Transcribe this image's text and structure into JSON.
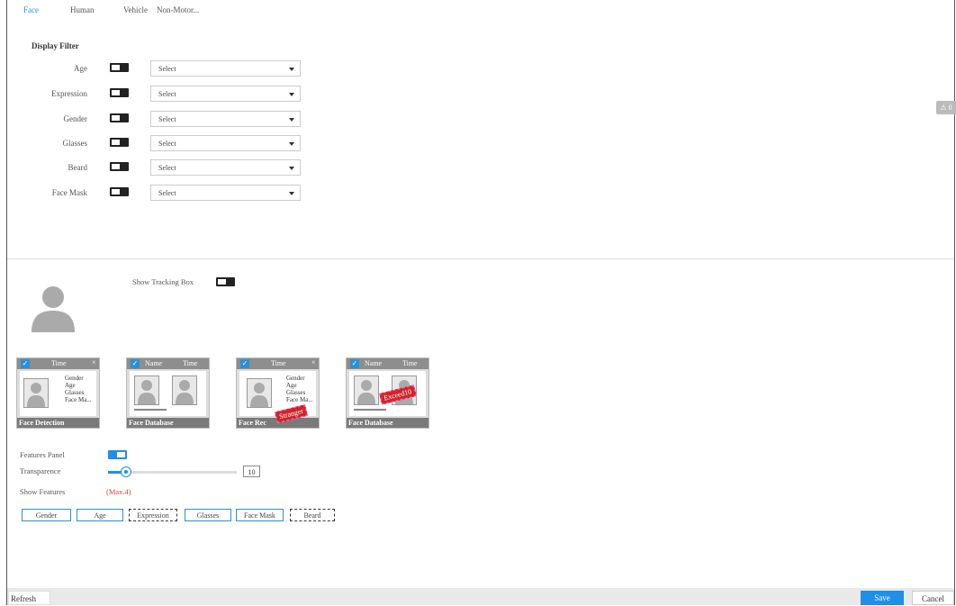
{
  "tabs": [
    "Face",
    "Human",
    "Vehicle",
    "Non-Motor..."
  ],
  "display_filter": {
    "title": "Display Filter",
    "rows": [
      {
        "label": "Age",
        "value": "Select"
      },
      {
        "label": "Expression",
        "value": "Select"
      },
      {
        "label": "Gender",
        "value": "Select"
      },
      {
        "label": "Glasses",
        "value": "Select"
      },
      {
        "label": "Beard",
        "value": "Select"
      },
      {
        "label": "Face Mask",
        "value": "Select"
      }
    ]
  },
  "alert_badge": "⚠ 0",
  "tracking": {
    "label": "Show Tracking Box"
  },
  "thumbnails": [
    {
      "col1": "Time",
      "col2": "",
      "footer": "Face Detection",
      "lines": [
        "Gender",
        "Age",
        "Glasses",
        "Face Ma..."
      ]
    },
    {
      "col1": "Name",
      "col2": "Time",
      "footer": "Face Database",
      "lines": []
    },
    {
      "col1": "Time",
      "col2": "",
      "footer": "Face Rec",
      "lines": [
        "Gender",
        "Age",
        "Glasses",
        "Face Ma..."
      ],
      "stamp": "Stranger"
    },
    {
      "col1": "Name",
      "col2": "Time",
      "footer": "Face Database",
      "lines": [],
      "stamp": "Exceed10"
    }
  ],
  "features_panel": {
    "label": "Features Panel",
    "enabled": true
  },
  "transparence": {
    "label": "Transparence",
    "value": "10",
    "level_percent": 14
  },
  "show_features": {
    "label": "Show Features",
    "hint": "(Max.4)",
    "chips": [
      {
        "label": "Gender",
        "selected": true
      },
      {
        "label": "Age",
        "selected": true
      },
      {
        "label": "Expression",
        "selected": false
      },
      {
        "label": "Glasses",
        "selected": true
      },
      {
        "label": "Face Mask",
        "selected": true
      },
      {
        "label": "Beard",
        "selected": false
      }
    ]
  },
  "buttons": {
    "refresh": "Refresh",
    "save": "Save",
    "cancel": "Cancel"
  },
  "colors": {
    "accent": "#1e90e6",
    "hint_red": "#e23b3b"
  }
}
